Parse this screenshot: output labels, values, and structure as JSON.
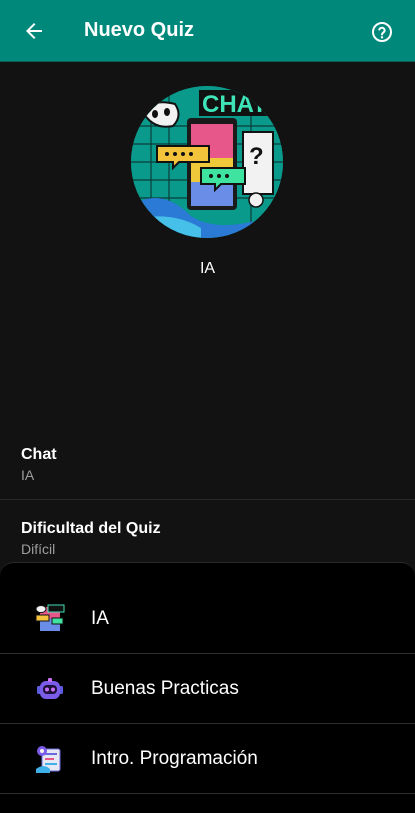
{
  "appbar": {
    "title": "Nuevo Quiz",
    "back_icon": "arrow-left-icon",
    "help_icon": "help-circle-icon",
    "background": "#00897b"
  },
  "header": {
    "avatar_icon": "chat-illustration",
    "avatar_name": "IA",
    "avatar_text": "CHAT"
  },
  "fields": {
    "chat": {
      "label": "Chat",
      "value": "IA"
    },
    "difficulty": {
      "label": "Dificultad del Quiz",
      "value": "Difícil"
    }
  },
  "sheet": {
    "items": [
      {
        "label": "IA",
        "icon": "chat-illustration-icon"
      },
      {
        "label": "Buenas Practicas",
        "icon": "robot-icon"
      },
      {
        "label": "Intro. Programación",
        "icon": "programming-icon"
      }
    ]
  }
}
